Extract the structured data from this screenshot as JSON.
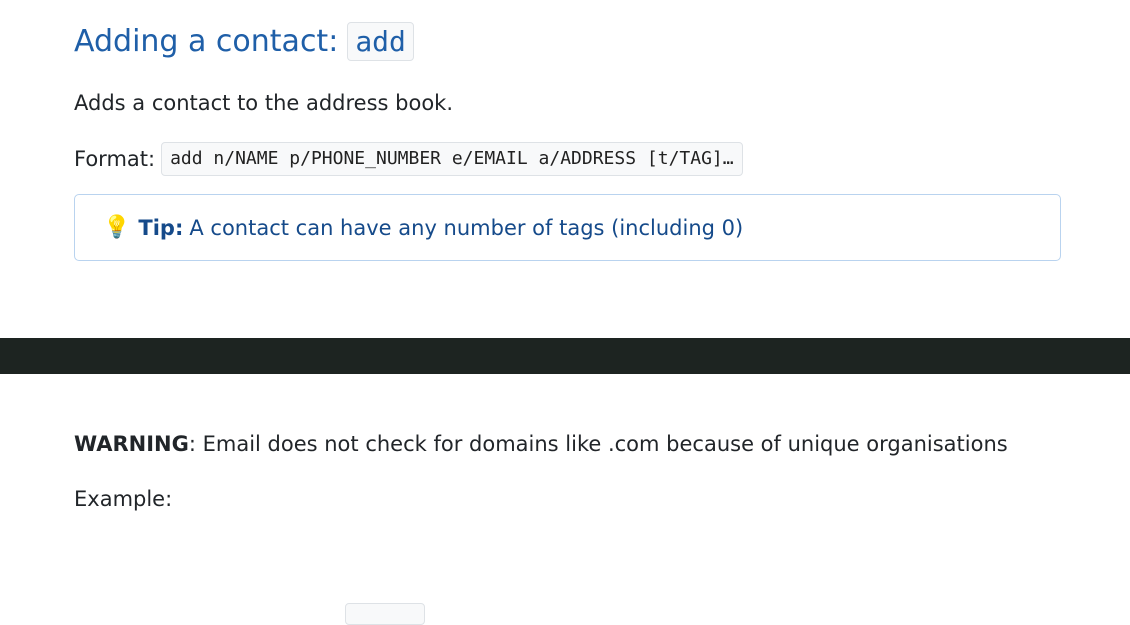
{
  "section": {
    "heading_text": "Adding a contact:",
    "heading_code": "add",
    "description": "Adds a contact to the address book.",
    "format_label": "Format:",
    "format_code": "add n/NAME p/PHONE_NUMBER e/EMAIL a/ADDRESS [t/TAG]…"
  },
  "tip": {
    "icon": "lightbulb-icon",
    "label": "Tip:",
    "text": "A contact can have any number of tags (including 0)"
  },
  "warning": {
    "label": "WARNING",
    "text": ": Email does not check for domains like .com because of unique organisations"
  },
  "example": {
    "label": "Example:"
  },
  "colors": {
    "heading": "#1f5fa8",
    "tip_border": "#b9d3ef",
    "tip_text": "#154a8a",
    "dark_band": "#1d2421"
  }
}
